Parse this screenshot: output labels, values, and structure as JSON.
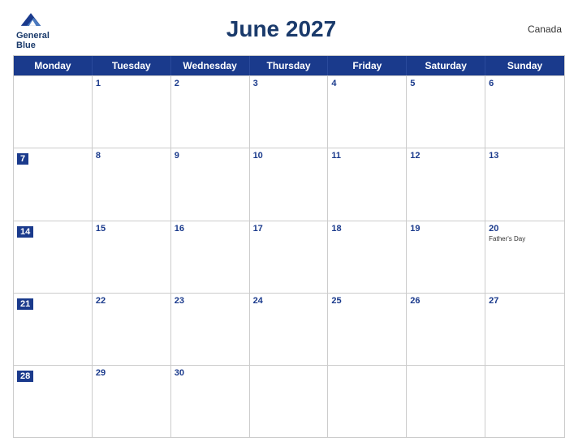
{
  "header": {
    "title": "June 2027",
    "country": "Canada",
    "logo_line1": "General",
    "logo_line2": "Blue"
  },
  "days_of_week": [
    "Monday",
    "Tuesday",
    "Wednesday",
    "Thursday",
    "Friday",
    "Saturday",
    "Sunday"
  ],
  "weeks": [
    [
      {
        "day": "",
        "event": "",
        "is_monday": false,
        "empty": true
      },
      {
        "day": "1",
        "event": "",
        "is_monday": false
      },
      {
        "day": "2",
        "event": "",
        "is_monday": false
      },
      {
        "day": "3",
        "event": "",
        "is_monday": false
      },
      {
        "day": "4",
        "event": "",
        "is_monday": false
      },
      {
        "day": "5",
        "event": "",
        "is_monday": false
      },
      {
        "day": "6",
        "event": "",
        "is_monday": false
      }
    ],
    [
      {
        "day": "7",
        "event": "",
        "is_monday": true
      },
      {
        "day": "8",
        "event": "",
        "is_monday": false
      },
      {
        "day": "9",
        "event": "",
        "is_monday": false
      },
      {
        "day": "10",
        "event": "",
        "is_monday": false
      },
      {
        "day": "11",
        "event": "",
        "is_monday": false
      },
      {
        "day": "12",
        "event": "",
        "is_monday": false
      },
      {
        "day": "13",
        "event": "",
        "is_monday": false
      }
    ],
    [
      {
        "day": "14",
        "event": "",
        "is_monday": true
      },
      {
        "day": "15",
        "event": "",
        "is_monday": false
      },
      {
        "day": "16",
        "event": "",
        "is_monday": false
      },
      {
        "day": "17",
        "event": "",
        "is_monday": false
      },
      {
        "day": "18",
        "event": "",
        "is_monday": false
      },
      {
        "day": "19",
        "event": "",
        "is_monday": false
      },
      {
        "day": "20",
        "event": "Father's Day",
        "is_monday": false
      }
    ],
    [
      {
        "day": "21",
        "event": "",
        "is_monday": true
      },
      {
        "day": "22",
        "event": "",
        "is_monday": false
      },
      {
        "day": "23",
        "event": "",
        "is_monday": false
      },
      {
        "day": "24",
        "event": "",
        "is_monday": false
      },
      {
        "day": "25",
        "event": "",
        "is_monday": false
      },
      {
        "day": "26",
        "event": "",
        "is_monday": false
      },
      {
        "day": "27",
        "event": "",
        "is_monday": false
      }
    ],
    [
      {
        "day": "28",
        "event": "",
        "is_monday": true
      },
      {
        "day": "29",
        "event": "",
        "is_monday": false
      },
      {
        "day": "30",
        "event": "",
        "is_monday": false
      },
      {
        "day": "",
        "event": "",
        "is_monday": false,
        "empty": true
      },
      {
        "day": "",
        "event": "",
        "is_monday": false,
        "empty": true
      },
      {
        "day": "",
        "event": "",
        "is_monday": false,
        "empty": true
      },
      {
        "day": "",
        "event": "",
        "is_monday": false,
        "empty": true
      }
    ]
  ],
  "colors": {
    "header_blue": "#1a3a8c",
    "text_dark": "#333",
    "border": "#ccc"
  }
}
